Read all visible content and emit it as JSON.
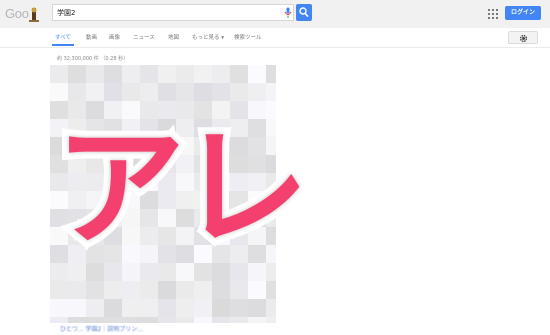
{
  "header": {
    "logo_text": "Goo",
    "search_value": "学園2",
    "login_label": "ログイン"
  },
  "tabs": [
    {
      "label": "すべて",
      "active": true
    },
    {
      "label": "動画",
      "active": false
    },
    {
      "label": "画像",
      "active": false
    },
    {
      "label": "ニュース",
      "active": false
    },
    {
      "label": "地図",
      "active": false
    },
    {
      "label": "もっと見る ▾",
      "active": false
    },
    {
      "label": "検索ツール",
      "active": false
    }
  ],
  "results": {
    "stats": "約 32,300,000 件 （0.28 秒）",
    "bottom_link_text": "ひとつ… 学園2｜説明プリン…"
  },
  "overlay": {
    "text": "アレ",
    "color": "#f4406f"
  },
  "colors": {
    "accent": "#4285f4",
    "topbar_bg": "#f1f1f1"
  },
  "icons": {
    "mic": "microphone-icon",
    "search": "magnifier-icon",
    "apps": "apps-grid-icon",
    "settings": "gear-icon"
  }
}
